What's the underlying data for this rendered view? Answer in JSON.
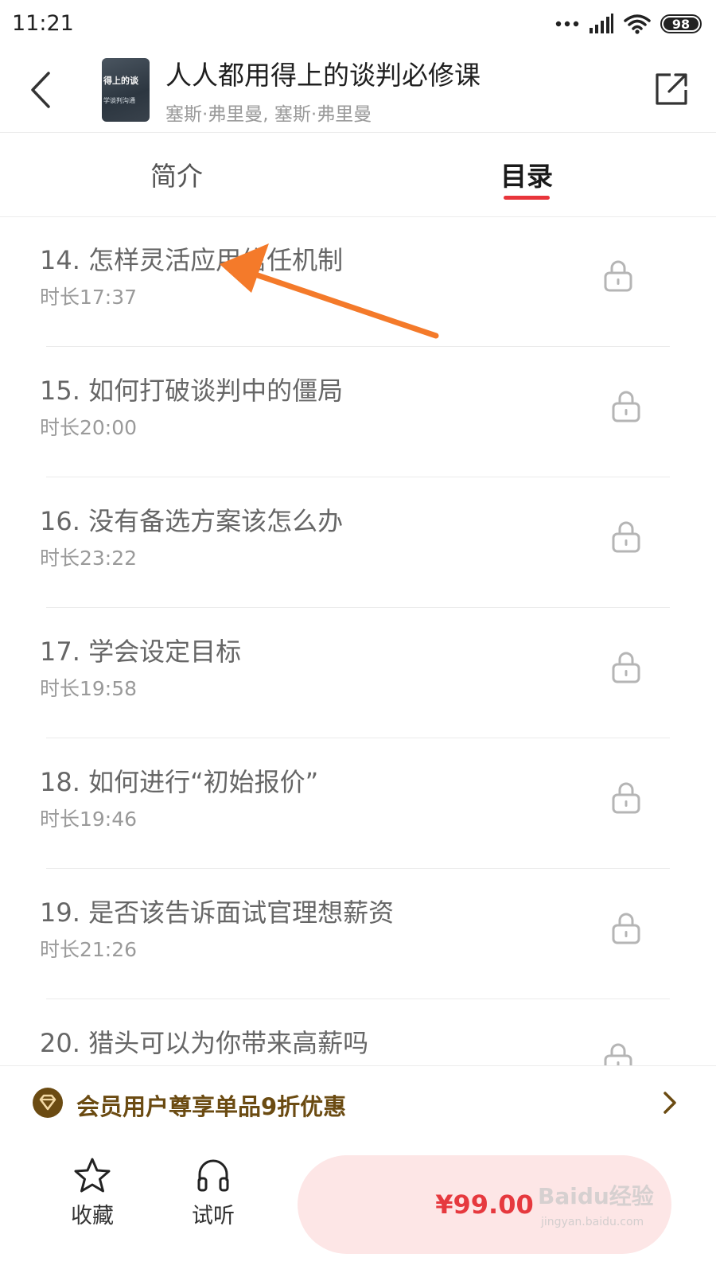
{
  "status_bar": {
    "time": "11:21",
    "battery": "98",
    "icons": [
      "dots-icon",
      "signal-icon",
      "wifi-icon",
      "battery-icon"
    ]
  },
  "header": {
    "title": "人人都用得上的谈判必修课",
    "authors": "塞斯·弗里曼, 塞斯·弗里曼",
    "cover_text_line1": "得上的谈",
    "cover_text_line2": "学谈判沟通",
    "back_icon": "chevron-left-icon",
    "share_icon": "share-icon"
  },
  "tabs": [
    {
      "label": "简介",
      "active": false
    },
    {
      "label": "目录",
      "active": true
    }
  ],
  "chapters": [
    {
      "title": "14. 怎样灵活应用信任机制",
      "duration": "时长17:37",
      "locked": true
    },
    {
      "title": "15. 如何打破谈判中的僵局",
      "duration": "时长20:00",
      "locked": true
    },
    {
      "title": "16. 没有备选方案该怎么办",
      "duration": "时长23:22",
      "locked": true
    },
    {
      "title": "17. 学会设定目标",
      "duration": "时长19:58",
      "locked": true
    },
    {
      "title": "18. 如何进行“初始报价”",
      "duration": "时长19:46",
      "locked": true
    },
    {
      "title": "19. 是否该告诉面试官理想薪资",
      "duration": "时长21:26",
      "locked": true
    },
    {
      "title": "20. 猎头可以为你带来高薪吗",
      "duration": "",
      "locked": true
    }
  ],
  "member_banner": {
    "text": "会员用户尊享单品9折优惠",
    "icon": "vip-diamond-icon",
    "text_color": "#6b4b12"
  },
  "bottom_bar": {
    "favorite_label": "收藏",
    "trial_label": "试听",
    "price": "¥99.00",
    "accent_color": "#e6393e"
  },
  "watermark": {
    "text": "Baidu经验",
    "url": "jingyan.baidu.com"
  }
}
